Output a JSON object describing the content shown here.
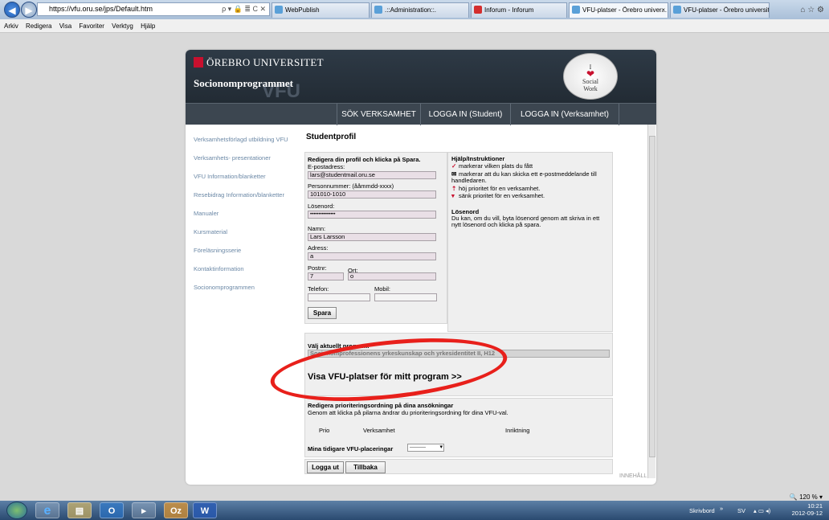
{
  "browser": {
    "address": "https://vfu.oru.se/jps/Default.htm",
    "address_controls": "ρ ▾ 🔒 ≣ C ✕",
    "tabs": [
      {
        "label": "WebPublish",
        "color": "#5aa0d8"
      },
      {
        "label": ".::Administration::.",
        "color": "#5aa0d8"
      },
      {
        "label": "Inforum - Inforum",
        "color": "#d42e2e"
      },
      {
        "label": "VFU-platser - Örebro univer...",
        "color": "#5aa0d8"
      },
      {
        "label": "VFU-platser - Örebro universitet",
        "color": "#5aa0d8"
      }
    ],
    "tab_close": "×",
    "toolbar_icons": "⌂ ☆ ⚙",
    "menu": [
      "Arkiv",
      "Redigera",
      "Visa",
      "Favoriter",
      "Verktyg",
      "Hjälp"
    ],
    "zoom": "🔍 120 %  ▾"
  },
  "site": {
    "university": "ÖREBRO UNIVERSITET",
    "program": "Socionomprogrammet",
    "watermark": "VFU",
    "badge_line1": "I",
    "badge_heart": "❤",
    "badge_line2": "Social",
    "badge_line3": "Work",
    "nav": [
      "SÖK VERKSAMHET",
      "LOGGA IN (Student)",
      "LOGGA IN (Verksamhet)"
    ],
    "sidebar": [
      "Verksamhetsförlagd utbildning VFU",
      "Verksamhets- presentationer",
      "VFU Information/blanketter",
      "Resebidrag Information/blanketter",
      "Manualer",
      "Kursmaterial",
      "Föreläsningsserie",
      "Kontaktinformation",
      "Socionomprogrammen"
    ],
    "footer": "INNEHÅLL"
  },
  "profile": {
    "title": "Studentprofil",
    "form_heading": "Redigera din profil och klicka på Spara.",
    "email_label": "E-postadress:",
    "email_value": "lars@studentmail.oru.se",
    "pnr_label": "Personnummer: (ååmmdd-xxxx)",
    "pnr_value": "101010-1010",
    "password_label": "Lösenord:",
    "password_value": "•••••••••••••••",
    "name_label": "Namn:",
    "name_value": "Lars Larsson",
    "address_label": "Adress:",
    "address_value": "a",
    "postnr_label": "Postnr:",
    "postnr_value": "7",
    "ort_label": "Ort:",
    "ort_value": "o",
    "phone_label": "Telefon:",
    "mobile_label": "Mobil:",
    "save_button": "Spara"
  },
  "help": {
    "heading": "Hjälp/Instruktioner",
    "check_icon": "✓",
    "check_text": "markerar vilken plats du fått",
    "mail_icon": "✉",
    "mail_text": "markerar att du kan skicka ett e-postmeddelande till handledaren.",
    "up_icon": "⇡",
    "up_text": "höj prioritet för en verksamhet.",
    "down_icon": "▾",
    "down_text": "sänk prioritet för en verksamhet.",
    "pw_heading": "Lösenord",
    "pw_text": "Du kan, om du vill, byta lösenord genom att skriva in ett nytt lösenord och klicka på spara."
  },
  "program": {
    "label": "Välj aktuellt program:",
    "selected": "Socionomprofessionens yrkeskunskap och yrkesidentitet II, H12",
    "link": "Visa VFU-platser för mitt program >>"
  },
  "priority": {
    "heading": "Redigera prioriteringsordning på dina ansökningar",
    "text": "Genom att klicka på pilarna ändrar du prioriteringsordning för dina VFU-val.",
    "col_prio": "Prio",
    "col_verksamhet": "Verksamhet",
    "col_inriktning": "Inriktning",
    "earlier_label": "Mina tidigare VFU-placeringar",
    "earlier_select": "----------",
    "select_arrow": "▾"
  },
  "actions": {
    "logout": "Logga ut",
    "back": "Tillbaka"
  },
  "taskbar": {
    "apps": [
      "e",
      "▤",
      "O",
      "▸",
      "Oz",
      "W"
    ],
    "desk": "Skrivbord",
    "chevron": "»",
    "lang": "SV",
    "tray_icons": "▴ ▭ ◂)",
    "time": "10:21",
    "date": "2012-09-12"
  }
}
